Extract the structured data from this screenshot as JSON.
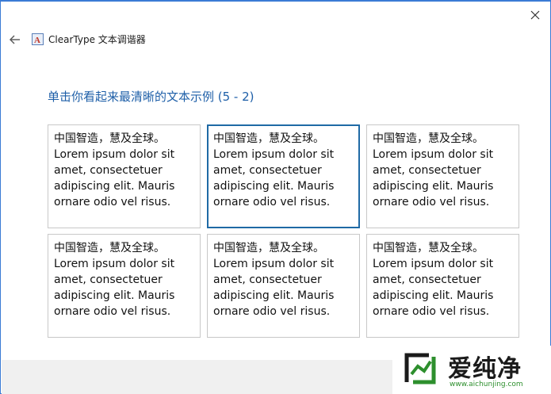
{
  "window": {
    "title": "ClearType 文本调谐器",
    "close_icon": "close-icon",
    "back_icon": "back-arrow-icon",
    "app_icon": "cleartype-app-icon"
  },
  "main": {
    "heading": "单击你看起来最清晰的文本示例 (5 - 2)"
  },
  "samples": [
    {
      "text": "中国智造，慧及全球。\nLorem ipsum dolor sit amet, consectetuer adipiscing elit. Mauris ornare odio vel risus.",
      "selected": false
    },
    {
      "text": "中国智造，慧及全球。\nLorem ipsum dolor sit amet, consectetuer adipiscing elit. Mauris ornare odio vel risus.",
      "selected": true
    },
    {
      "text": "中国智造，慧及全球。\nLorem ipsum dolor sit amet, consectetuer adipiscing elit. Mauris ornare odio vel risus.",
      "selected": false
    },
    {
      "text": "中国智造，慧及全球。\nLorem ipsum dolor sit amet, consectetuer adipiscing elit. Mauris ornare odio vel risus.",
      "selected": false
    },
    {
      "text": "中国智造，慧及全球。\nLorem ipsum dolor sit amet, consectetuer adipiscing elit. Mauris ornare odio vel risus.",
      "selected": false
    },
    {
      "text": "中国智造，慧及全球。\nLorem ipsum dolor sit amet, consectetuer adipiscing elit. Mauris ornare odio vel risus.",
      "selected": false
    }
  ],
  "watermark": {
    "brand": "爱纯净",
    "url": "www.aichunjing.com"
  },
  "colors": {
    "heading": "#1e5fa8",
    "selected_border": "#1f6aa5",
    "sample_border": "#c8c8c8",
    "footer": "#f0f0f0"
  }
}
